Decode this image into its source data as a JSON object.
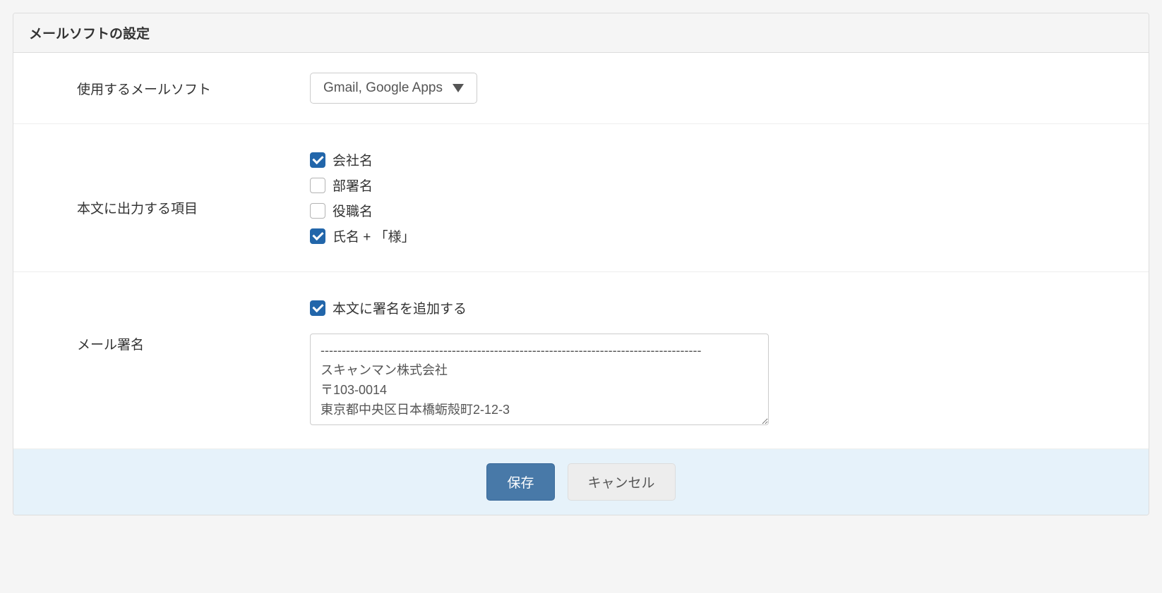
{
  "header": {
    "title": "メールソフトの設定"
  },
  "rows": {
    "mail_software": {
      "label": "使用するメールソフト",
      "selected": "Gmail, Google Apps"
    },
    "output_items": {
      "label": "本文に出力する項目",
      "items": [
        {
          "label": "会社名",
          "checked": true
        },
        {
          "label": "部署名",
          "checked": false
        },
        {
          "label": "役職名",
          "checked": false
        },
        {
          "label": "氏名 + 「様」",
          "checked": true
        }
      ]
    },
    "signature": {
      "label": "メール署名",
      "add_checkbox_label": "本文に署名を追加する",
      "add_checkbox_checked": true,
      "text": "------------------------------------------------------------------------------------------\nスキャンマン株式会社\n〒103-0014\n東京都中央区日本橋蛎殻町2-12-3"
    }
  },
  "footer": {
    "save": "保存",
    "cancel": "キャンセル"
  }
}
